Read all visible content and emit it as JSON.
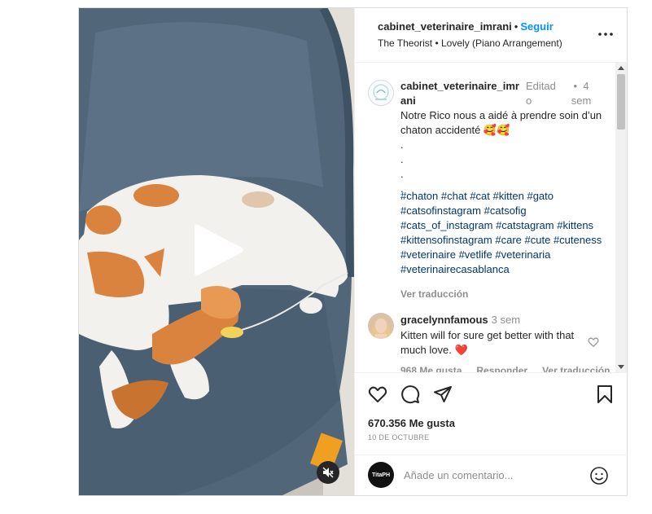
{
  "header": {
    "username": "cabinet_veterinaire_imrani",
    "separator": "•",
    "follow_label": "Seguir",
    "audio": "The Theorist • Lovely (Piano Arrangement)"
  },
  "caption": {
    "username_line1": "cabinet_veterinaire_imr",
    "username_line2": "ani",
    "edited_line1": "Editad",
    "edited_line2": "o",
    "time_dot": "•",
    "time_line1": "4",
    "time_line2": "sem",
    "text": "Notre Rico nous a aidé à prendre soin d’un chaton accidenté 🥰🥰",
    "dots": [
      ".",
      ".",
      ".",
      "."
    ],
    "hashtags": [
      "#chaton",
      "#chat",
      "#cat",
      "#kitten",
      "#gato",
      "#catsofinstagram",
      "#catsofig",
      "#cats_of_instagram",
      "#catstagram",
      "#kittens",
      "#kittensofinstagram",
      "#care",
      "#cute",
      "#cuteness",
      "#veterinaire",
      "#vetlife",
      "#veterinaria",
      "#veterinairecasablanca"
    ],
    "translate_label": "Ver traducción"
  },
  "comment": {
    "username": "gracelynnfamous",
    "time": "3 sem",
    "text": "Kitten will for sure get better with that much love. ❤️",
    "likes": "968 Me gusta",
    "reply_label": "Responder",
    "translate_label": "Ver traducción"
  },
  "actions": {
    "likes": "670.356 Me gusta",
    "date": "10 DE OCTUBRE"
  },
  "add_comment": {
    "avatar_text": "TitaPH",
    "placeholder": "Añade un comentario..."
  },
  "colors": {
    "accent": "#0095f6",
    "hashtag": "#00376b",
    "muted": "#8e8e8e",
    "heart_red": "#ed1c24"
  },
  "icons": [
    "play-icon",
    "mute-icon",
    "more-icon",
    "heart-icon",
    "comment-icon",
    "share-icon",
    "save-icon",
    "emoji-icon"
  ]
}
